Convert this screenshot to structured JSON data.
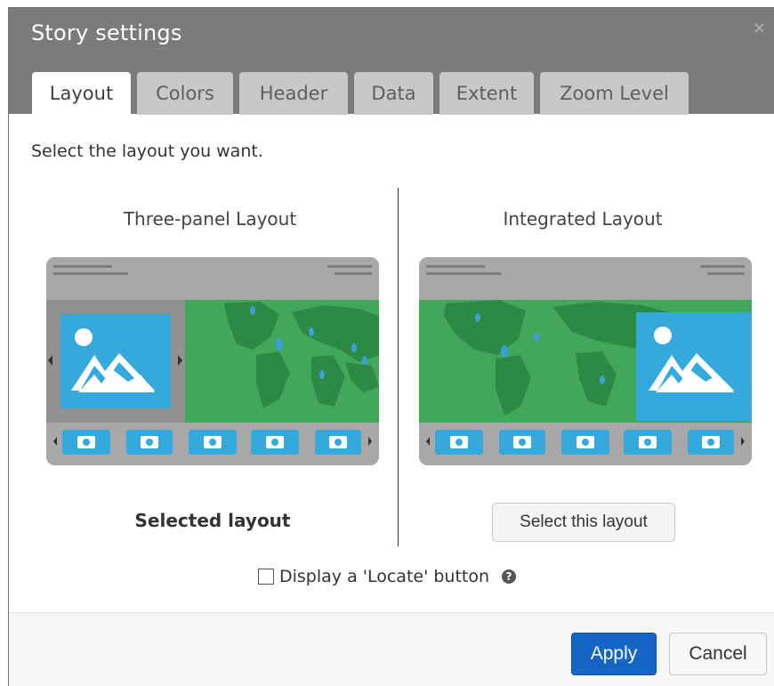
{
  "dialog": {
    "title": "Story settings",
    "close_glyph": "×"
  },
  "tabs": [
    {
      "label": "Layout",
      "active": true
    },
    {
      "label": "Colors",
      "active": false
    },
    {
      "label": "Header",
      "active": false
    },
    {
      "label": "Data",
      "active": false
    },
    {
      "label": "Extent",
      "active": false
    },
    {
      "label": "Zoom Level",
      "active": false
    }
  ],
  "content": {
    "instruction": "Select the layout you want.",
    "layouts": [
      {
        "title": "Three-panel Layout",
        "status": "Selected layout"
      },
      {
        "title": "Integrated Layout",
        "button": "Select this layout"
      }
    ],
    "locate": {
      "label": "Display a 'Locate' button",
      "checked": false,
      "help_glyph": "?"
    }
  },
  "footer": {
    "apply": "Apply",
    "cancel": "Cancel"
  },
  "colors": {
    "header": "#7b7b7b",
    "tab": "#c8c8c8",
    "accent": "#1565c7",
    "map_ocean": "#43a75b",
    "map_land": "#2d8a45",
    "media_blue": "#35a8dc"
  },
  "icons": [
    "close-icon",
    "image-icon",
    "camera-icon",
    "chevron-left-icon",
    "chevron-right-icon",
    "help-icon"
  ]
}
